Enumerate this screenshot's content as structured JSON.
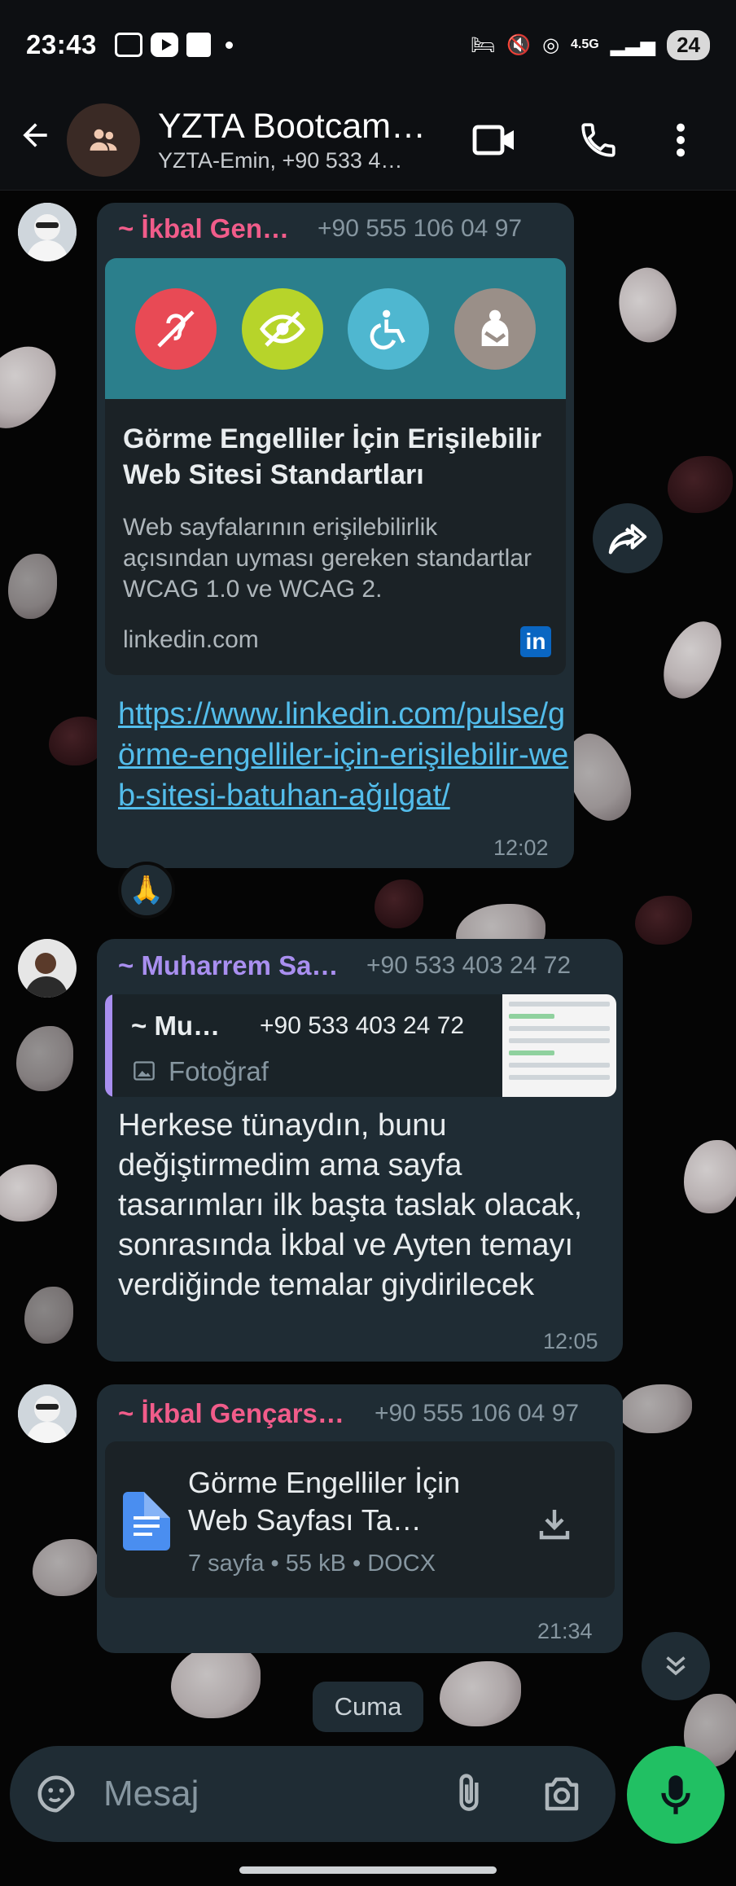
{
  "status_bar": {
    "time": "23:43",
    "network": "4.5G",
    "battery": "24"
  },
  "header": {
    "title": "YZTA Bootcam…",
    "subtitle": "YZTA-Emin, +90 533 4…"
  },
  "messages": [
    {
      "sender": "~ İkbal Gen…",
      "phone": "+90 555 106 04 97",
      "link_preview": {
        "title": "Görme Engelliler İçin Erişilebilir Web Sitesi Standartları",
        "description": "Web sayfalarının erişilebilirlik açısından uyması gereken standartlar WCAG 1.0 ve WCAG 2.",
        "domain": "linkedin.com",
        "badge": "in"
      },
      "link": "https://www.linkedin.com/pulse/görme-engelliler-için-erişilebilir-web-sitesi-batuhan-ağılgat/",
      "time": "12:02",
      "reaction": "🙏"
    },
    {
      "sender": "~ Muharrem Sa…",
      "phone": "+90 533 403 24 72",
      "quote": {
        "sender": "~ Mu…",
        "phone": "+90 533 403 24 72",
        "type": "Fotoğraf"
      },
      "text": "Herkese tünaydın, bunu değiştirmedim ama sayfa tasarımları ilk başta taslak olacak, sonrasında İkbal ve Ayten temayı verdiğinde temalar giydirilecek",
      "time": "12:05"
    },
    {
      "sender": "~ İkbal Gençars…",
      "phone": "+90 555 106 04 97",
      "document": {
        "name": "Görme Engelliler İçin Web Sayfası Ta…",
        "meta": "7 sayfa • 55 kB • DOCX"
      },
      "time": "21:34"
    }
  ],
  "date_divider": "Cuma",
  "composer": {
    "placeholder": "Mesaj"
  },
  "colors": {
    "accent": "#21c063",
    "sender_pink": "#f15c8a",
    "sender_purple": "#a98ff0",
    "link": "#53bdeb",
    "bubble": "#1f2c34"
  }
}
